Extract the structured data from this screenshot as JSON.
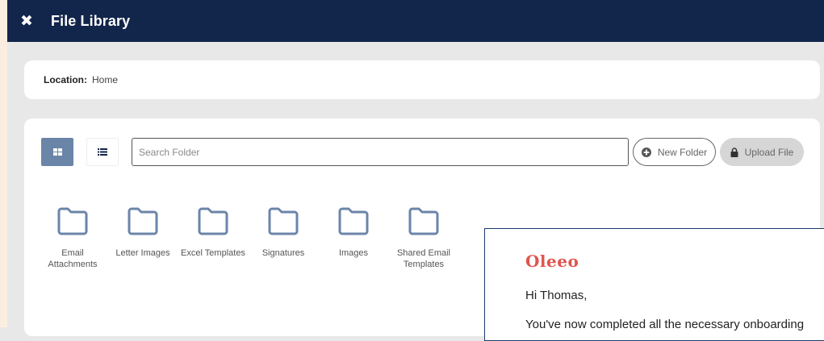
{
  "header": {
    "title": "File Library",
    "close_icon": "close-icon"
  },
  "location": {
    "label": "Location:",
    "value": "Home"
  },
  "toolbar": {
    "grid_view_icon": "grid-view-icon",
    "list_view_icon": "list-view-icon",
    "search_placeholder": "Search Folder",
    "search_value": "",
    "new_folder_label": "New Folder",
    "upload_file_label": "Upload File"
  },
  "folders": [
    {
      "label": "Email Attachments"
    },
    {
      "label": "Letter Images"
    },
    {
      "label": "Excel Templates"
    },
    {
      "label": "Signatures"
    },
    {
      "label": "Images"
    },
    {
      "label": "Shared Email Templates"
    }
  ],
  "email_preview": {
    "brand": "Oleeo",
    "greeting": "Hi Thomas,",
    "body": "You've now completed all the necessary onboarding"
  },
  "colors": {
    "header_bg": "#12254a",
    "active_view_bg": "#6b85a8",
    "folder_icon": "#6b85a8",
    "brand": "#e0554f"
  }
}
